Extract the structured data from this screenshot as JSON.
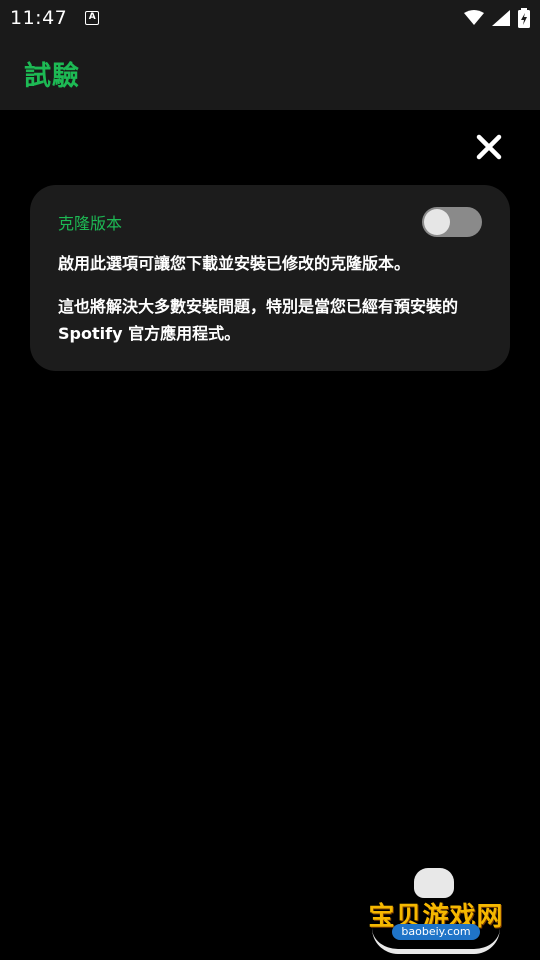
{
  "status_bar": {
    "time": "11:47",
    "notification_icon_letter": "A",
    "icons": [
      "wifi-icon",
      "signal-icon",
      "battery-charging-icon"
    ]
  },
  "app_bar": {
    "title": "試驗"
  },
  "close_icon": "close-icon",
  "card": {
    "title": "克隆版本",
    "toggle_on": false,
    "description_1": "啟用此選項可讓您下載並安裝已修改的克隆版本。",
    "description_2": "這也將解決大多數安裝問題，特別是當您已經有預安裝的 Spotify 官方應用程式。"
  },
  "watermark": {
    "brand": "宝贝游戏网",
    "url": "baobeiy.com"
  },
  "colors": {
    "accent": "#1DB954",
    "background": "#000000",
    "bar": "#1a1a1a",
    "card": "#1c1c1c"
  }
}
